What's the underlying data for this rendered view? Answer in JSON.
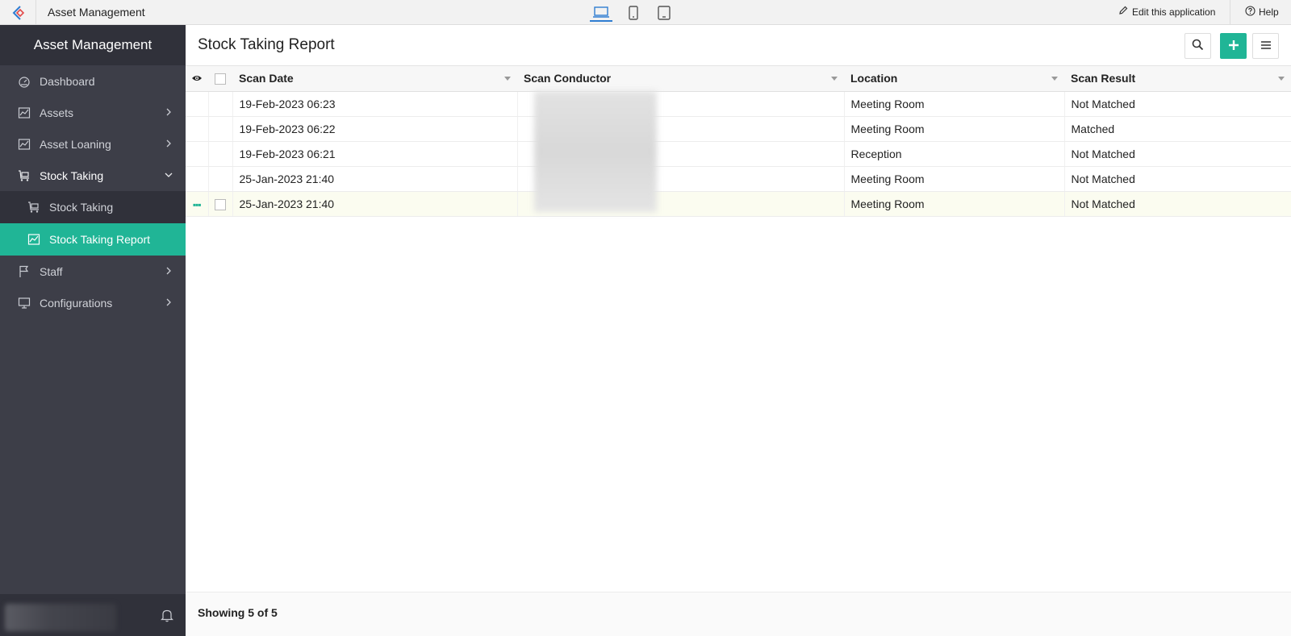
{
  "topbar": {
    "app_title": "Asset Management",
    "edit_label": "Edit this application",
    "help_label": "Help",
    "devices": [
      "desktop-icon",
      "mobile-icon",
      "tablet-icon"
    ]
  },
  "sidebar": {
    "brand": "Asset Management",
    "items": [
      {
        "label": "Dashboard",
        "icon": "dashboard-icon"
      },
      {
        "label": "Assets",
        "icon": "chart-icon",
        "chevron": "right"
      },
      {
        "label": "Asset Loaning",
        "icon": "chart-icon",
        "chevron": "right"
      },
      {
        "label": "Stock Taking",
        "icon": "cart-icon",
        "chevron": "down"
      },
      {
        "label": "Stock Taking",
        "icon": "cart-icon",
        "sub": true
      },
      {
        "label": "Stock Taking Report",
        "icon": "chart-icon",
        "sub": true,
        "active": true
      },
      {
        "label": "Staff",
        "icon": "flag-icon",
        "chevron": "right"
      },
      {
        "label": "Configurations",
        "icon": "monitor-icon",
        "chevron": "right"
      }
    ]
  },
  "main": {
    "title": "Stock Taking Report",
    "columns": [
      "Scan Date",
      "Scan Conductor",
      "Location",
      "Scan Result"
    ],
    "rows": [
      {
        "date": "19-Feb-2023 06:23",
        "conductor": "",
        "location": "Meeting Room",
        "result": "Not Matched"
      },
      {
        "date": "19-Feb-2023 06:22",
        "conductor": "",
        "location": "Meeting Room",
        "result": "Matched"
      },
      {
        "date": "19-Feb-2023 06:21",
        "conductor": "",
        "location": "Reception",
        "result": "Not Matched"
      },
      {
        "date": "25-Jan-2023 21:40",
        "conductor": "",
        "location": "Meeting Room",
        "result": "Not Matched"
      },
      {
        "date": "25-Jan-2023 21:40",
        "conductor": "",
        "location": "Meeting Room",
        "result": "Not Matched"
      }
    ],
    "status": "Showing 5 of 5"
  },
  "colors": {
    "accent": "#20b596",
    "sidebar": "#3d3e48",
    "sidebar_dark": "#30313a"
  }
}
